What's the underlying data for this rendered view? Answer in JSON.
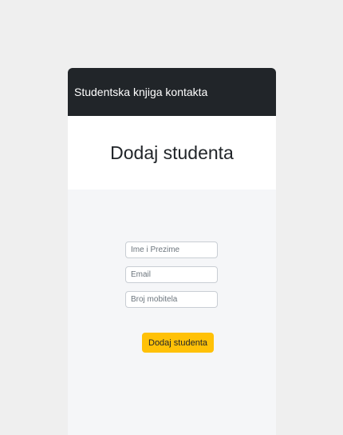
{
  "navbar": {
    "brand": "Studentska knjiga kontakta"
  },
  "page": {
    "title": "Dodaj studenta"
  },
  "form": {
    "name_placeholder": "Ime i Prezime",
    "name_value": "",
    "email_placeholder": "Email",
    "email_value": "",
    "phone_placeholder": "Broj mobitela",
    "phone_value": "",
    "submit_label": "Dodaj studenta"
  },
  "colors": {
    "navbar_bg": "#212529",
    "submit_bg": "#ffc107"
  }
}
